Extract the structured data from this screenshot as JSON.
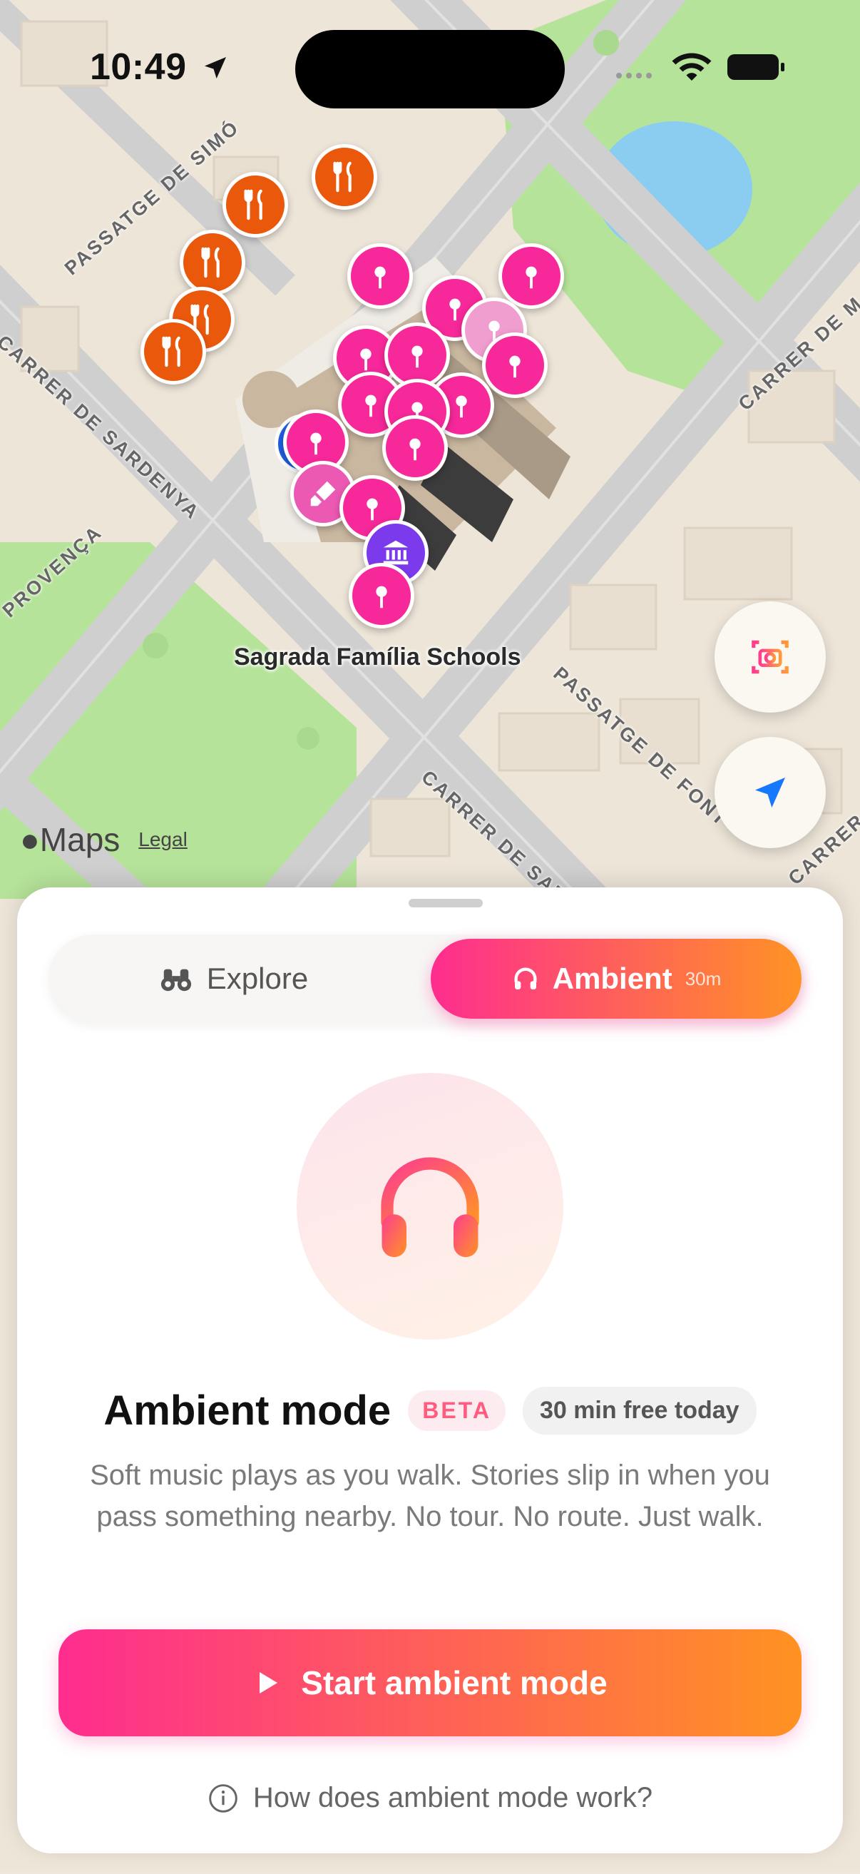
{
  "status_bar": {
    "time": "10:49"
  },
  "map": {
    "place_label": "Sagrada Família Schools",
    "streets": [
      "PASSATGE DE SIMÓ",
      "CARRER DE SARDENYA",
      "PROVENÇA",
      "CARRER DE M",
      "PASSATGE DE FONT",
      "CARRER DE SAR",
      "CARRER"
    ],
    "attribution": {
      "logo": "Maps",
      "legal": "Legal"
    },
    "colors": {
      "tour_pin": "#f7289a",
      "food_pin": "#ea580c",
      "museum_pin": "#7c3aed",
      "user_dot": "#1f5fe0"
    }
  },
  "sheet": {
    "tabs": [
      {
        "label": "Explore",
        "icon": "binoculars-icon",
        "selected": false
      },
      {
        "label": "Ambient",
        "icon": "headphones-icon",
        "badge": "30m",
        "selected": true
      }
    ],
    "title": "Ambient mode",
    "beta_badge": "BETA",
    "free_badge": "30 min free today",
    "description": "Soft music plays as you walk. Stories slip in when you pass something nearby. No tour. No route. Just walk.",
    "cta_label": "Start ambient mode",
    "help_link": "How does ambient mode work?",
    "accent_gradient": [
      "#fe2d8f",
      "#ff9325"
    ]
  }
}
